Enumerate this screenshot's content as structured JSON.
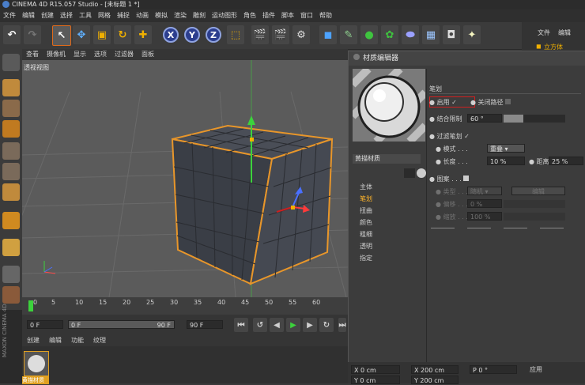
{
  "title": "CINEMA 4D R15.057 Studio - [未标题 1 *]",
  "menu": [
    "文件",
    "编辑",
    "创建",
    "选择",
    "工具",
    "网格",
    "捕捉",
    "动画",
    "模拟",
    "渲染",
    "雕刻",
    "运动图形",
    "角色",
    "插件",
    "脚本",
    "窗口",
    "帮助"
  ],
  "axis_buttons": [
    "X",
    "Y",
    "Z"
  ],
  "right_panel": {
    "file": "文件",
    "edit": "编辑",
    "object": "立方体"
  },
  "view_menu": [
    "查看",
    "摄像机",
    "显示",
    "选项",
    "过滤器",
    "面板"
  ],
  "viewport_label": "透视视图",
  "timeline_ticks": [
    "0",
    "5",
    "10",
    "15",
    "20",
    "25",
    "30",
    "35",
    "40",
    "45",
    "50",
    "55",
    "60"
  ],
  "playback": {
    "start": "0 F",
    "current": "0 F",
    "end": "90 F",
    "end2": "90 F"
  },
  "material_bar": [
    "创建",
    "编辑",
    "功能",
    "纹理"
  ],
  "material_item_label": "黄描材质",
  "brand_vertical": "MAXON CINEMA 4D",
  "editor": {
    "title": "材质编辑器",
    "material_name": "黄描材质",
    "channels": [
      "主体",
      "笔划",
      "扭曲",
      "颜色",
      "粗细",
      "透明",
      "指定"
    ],
    "active_channel": "笔划",
    "section": "笔划",
    "enable_label": "启用",
    "enable_check": "✓",
    "close_path_label": "关闭路径",
    "merge_angle_label": "结合限制",
    "merge_angle_value": "60 °",
    "merge_angle_fill": 0.32,
    "filter_label": "过滤笔划",
    "filter_check": "✓",
    "mode_label": "模式",
    "mode_value": "重叠",
    "length_label": "长度",
    "length_value": "10 %",
    "distance_label": "距离",
    "distance_value": "25 %",
    "pattern_label": "图案",
    "type_label": "类型",
    "type_value": "随机",
    "edit_button": "编辑",
    "offset_label": "偏移",
    "offset_value": "0 %",
    "scale_label": "缩放",
    "scale_value": "100 %"
  },
  "coords": {
    "x": "X  0 cm",
    "y": "Y  0 cm",
    "x2": "X  200 cm",
    "y2": "Y  200 cm",
    "p": "P  0 °",
    "apply": "应用"
  }
}
